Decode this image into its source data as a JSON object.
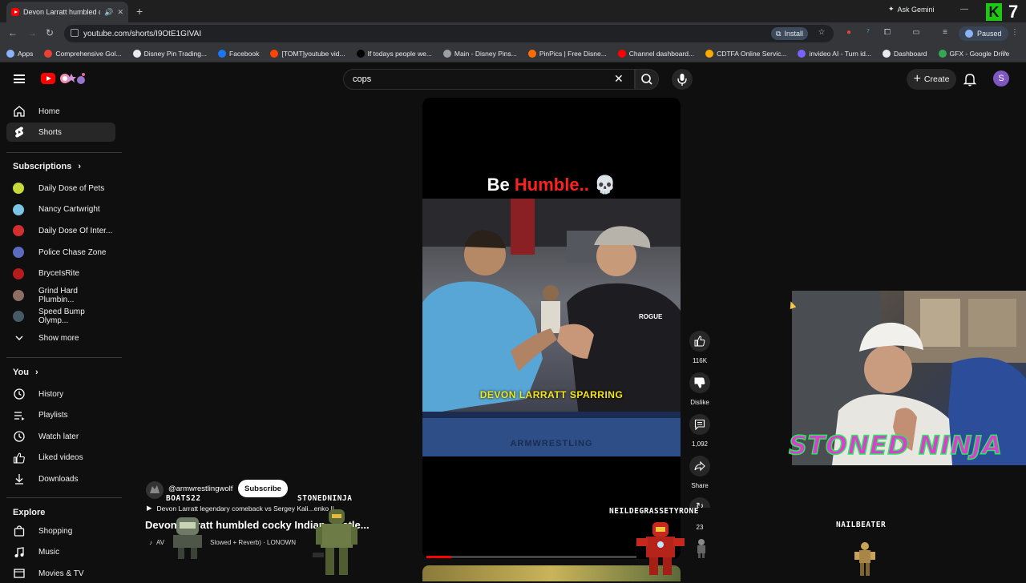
{
  "browser": {
    "tab_title": "Devon Larratt humbled cocl",
    "tab_close": "✕",
    "new_tab": "+",
    "gemini_label": "Ask Gemini",
    "window_controls": "—",
    "k_logo": "K",
    "k_number": "7",
    "url": "youtube.com/shorts/I9OtE1GIVAI",
    "install_label": "Install",
    "profile_status": "Paused",
    "bookmarks": [
      {
        "label": "Apps",
        "color": "#8ab4f8"
      },
      {
        "label": "Comprehensive Gol...",
        "color": "#e94235"
      },
      {
        "label": "Disney Pin Trading...",
        "color": "#e8eaed"
      },
      {
        "label": "Facebook",
        "color": "#1877f2"
      },
      {
        "label": "[TOMT]youtube vid...",
        "color": "#ff4500"
      },
      {
        "label": "If todays people we...",
        "color": "#000000"
      },
      {
        "label": "Main - Disney Pins...",
        "color": "#9aa0a6"
      },
      {
        "label": "PinPics | Free Disne...",
        "color": "#ff6d00"
      },
      {
        "label": "Channel dashboard...",
        "color": "#ff0000"
      },
      {
        "label": "CDTFA Online Servic...",
        "color": "#f9ab00"
      },
      {
        "label": "invideo AI - Turn id...",
        "color": "#7b61ff"
      },
      {
        "label": "Dashboard",
        "color": "#e8eaed"
      },
      {
        "label": "GFX - Google Drive",
        "color": "#34a853"
      }
    ]
  },
  "header": {
    "search_value": "cops",
    "create_label": "Create",
    "avatar_letter": "S"
  },
  "sidebar": {
    "main": [
      {
        "label": "Home",
        "icon": "home-icon"
      },
      {
        "label": "Shorts",
        "icon": "shorts-icon",
        "active": true
      }
    ],
    "subscriptions_heading": "Subscriptions",
    "subscriptions": [
      {
        "label": "Daily Dose of Pets",
        "color": "#c5d93a"
      },
      {
        "label": "Nancy Cartwright",
        "color": "#7cc4e4"
      },
      {
        "label": "Daily Dose Of Inter...",
        "color": "#d32f2f"
      },
      {
        "label": "Police Chase Zone",
        "color": "#5c6bc0"
      },
      {
        "label": "BryceIsRite",
        "color": "#b71c1c"
      },
      {
        "label": "Grind Hard Plumbin...",
        "color": "#8d6e63"
      },
      {
        "label": "Speed Bump Olymp...",
        "color": "#455a64"
      }
    ],
    "show_more": "Show more",
    "you_heading": "You",
    "you_items": [
      {
        "label": "History",
        "icon": "history-icon"
      },
      {
        "label": "Playlists",
        "icon": "playlists-icon"
      },
      {
        "label": "Watch later",
        "icon": "watch-later-icon"
      },
      {
        "label": "Liked videos",
        "icon": "like-icon"
      },
      {
        "label": "Downloads",
        "icon": "download-icon"
      }
    ],
    "explore_heading": "Explore",
    "explore_items": [
      {
        "label": "Shopping",
        "icon": "shopping-icon"
      },
      {
        "label": "Music",
        "icon": "music-icon"
      },
      {
        "label": "Movies & TV",
        "icon": "movies-icon"
      }
    ]
  },
  "short": {
    "title_white": "Be ",
    "title_red": "Humble..",
    "title_emoji": "💀",
    "caption": "DEVON LARRATT SPARRING",
    "gym_logo": "ARMWRESTLING",
    "progress": 0.12
  },
  "actions": {
    "likes": "116K",
    "dislike_label": "Dislike",
    "comments": "1,092",
    "share_label": "Share",
    "remix_count": "23"
  },
  "meta": {
    "channel": "@armwrestlingwolf",
    "subscribe_label": "Subscribe",
    "playlist_text": "Devon Larratt legendary comeback vs Sergey Kali...enko || ...",
    "video_title": "Devon Larratt humbled cocky Indian ...estle...",
    "sound_prefix": "AV",
    "sound_text": "Slowed + Reverb) · LONOWN"
  },
  "overlay": {
    "stoned_ninja": "STONED NINJA",
    "names": [
      "BOATS22",
      "STONEDNINJA",
      "NEILDEGRASSETYRONE",
      "NAILBEATER"
    ]
  }
}
